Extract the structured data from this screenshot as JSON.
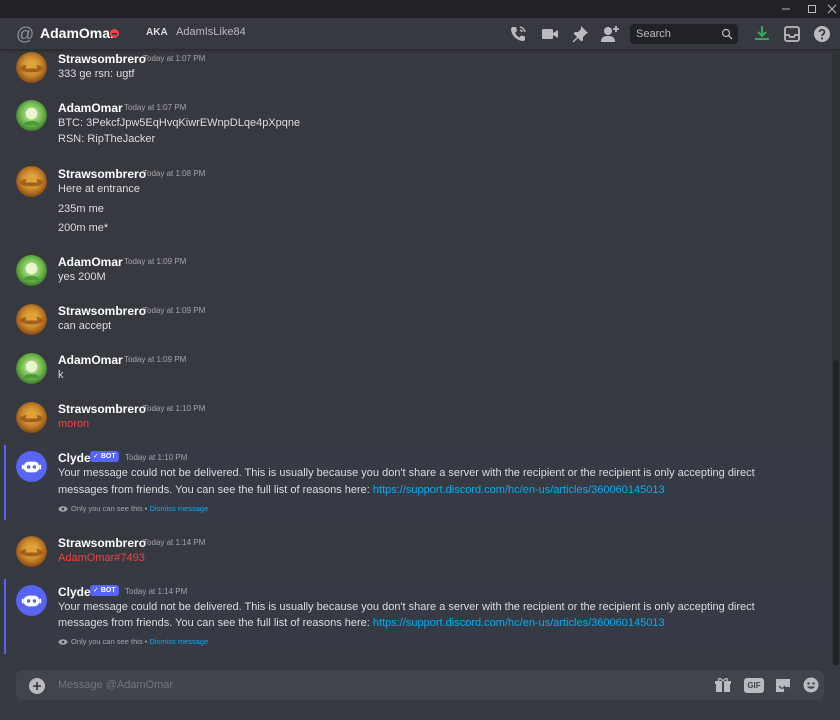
{
  "header": {
    "dm_name": "AdamOmar",
    "aka_label": "AKA",
    "aka_name": "AdamIsLike84",
    "search_placeholder": "Search"
  },
  "messages": [
    {
      "author": "Strawsombrero",
      "time": "Today at 1:07 PM",
      "lines": [
        "333 ge rsn: ugtf"
      ]
    },
    {
      "author": "AdamOmar",
      "time": "Today at 1:07 PM",
      "lines": [
        "BTC: 3PekcfJpw5EqHvqKiwrEWnpDLqe4pXpqne",
        "RSN: RipTheJacker"
      ]
    },
    {
      "author": "Strawsombrero",
      "time": "Today at 1:08 PM",
      "lines": [
        "Here at entrance",
        "235m me",
        "200m me*"
      ]
    },
    {
      "author": "AdamOmar",
      "time": "Today at 1:09 PM",
      "lines": [
        "yes 200M"
      ]
    },
    {
      "author": "Strawsombrero",
      "time": "Today at 1:09 PM",
      "lines": [
        "can accept"
      ]
    },
    {
      "author": "AdamOmar",
      "time": "Today at 1:09 PM",
      "lines": [
        "k"
      ]
    },
    {
      "author": "Strawsombrero",
      "time": "Today at 1:10 PM",
      "lines": [
        "moron"
      ]
    },
    {
      "author": "Clyde",
      "bot_label": "BOT",
      "time": "Today at 1:10 PM",
      "line1": "Your message could not be delivered. This is usually because you don't share a server with the recipient or the recipient is only accepting direct",
      "line2_prefix": "messages from friends. You can see the full list of reasons here: ",
      "link": "https://support.discord.com/hc/en-us/articles/360060145013",
      "ephemeral": "Only you can see this • ",
      "dismiss": "Dismiss message"
    },
    {
      "author": "Strawsombrero",
      "time": "Today at 1:14 PM",
      "lines": [
        "AdamOmar#7493"
      ]
    },
    {
      "author": "Clyde",
      "bot_label": "BOT",
      "time": "Today at 1:14 PM",
      "line1": "Your message could not be delivered. This is usually because you don't share a server with the recipient or the recipient is only accepting direct",
      "line2_prefix": "messages from friends. You can see the full list of reasons here: ",
      "link": "https://support.discord.com/hc/en-us/articles/360060145013",
      "ephemeral": "Only you can see this • ",
      "dismiss": "Dismiss message"
    }
  ],
  "composer": {
    "placeholder": "Message @AdamOmar",
    "gif_label": "GIF"
  },
  "colors": {
    "background": "#36393f",
    "titlebar": "#202225",
    "blurple": "#5865f2",
    "link": "#00aff4",
    "red_text": "#ed4245",
    "dnd_status": "#ed4245",
    "download_green": "#3ba55d"
  }
}
